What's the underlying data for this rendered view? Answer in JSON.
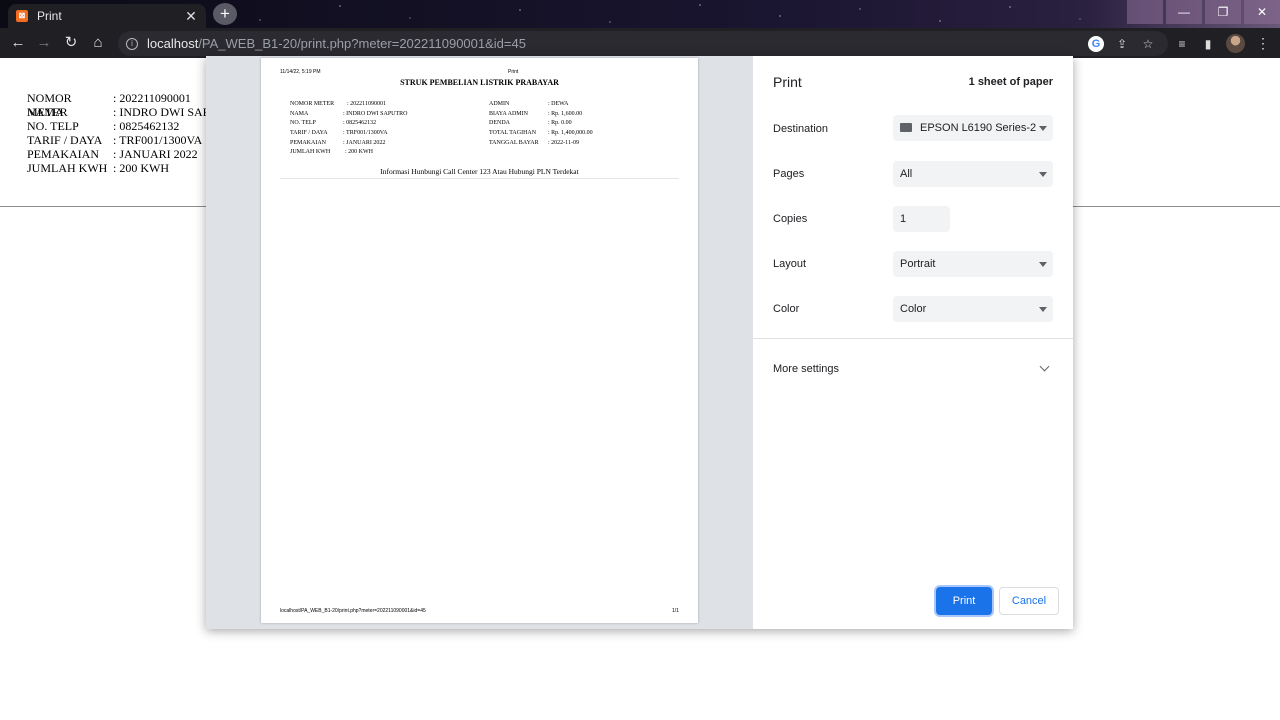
{
  "browser": {
    "tab_title": "Print",
    "url_host": "localhost",
    "url_path": "/PA_WEB_B1-20/print.php?meter=202211090001&id=45"
  },
  "underlay": {
    "rows": [
      {
        "k": "NOMOR METER",
        "v": ": 202211090001"
      },
      {
        "k": "NAMA",
        "v": ": INDRO DWI SAPUT"
      },
      {
        "k": "NO. TELP",
        "v": ": 0825462132"
      },
      {
        "k": "TARIF / DAYA",
        "v": ": TRF001/1300VA"
      },
      {
        "k": "PEMAKAIAN",
        "v": ": JANUARI 2022"
      },
      {
        "k": "JUMLAH KWH",
        "v": ": 200 KWH"
      }
    ]
  },
  "preview": {
    "header_date": "11/14/22, 5:19 PM",
    "header_title": "Print",
    "title": "STRUK PEMBELIAN LISTRIK PRABAYAR",
    "left_rows": [
      {
        "k": "NOMOR METER",
        "v": ": 202211090001"
      },
      {
        "k": "NAMA",
        "v": ": INDRO DWI SAPUTRO"
      },
      {
        "k": "NO. TELP",
        "v": ": 0825462132"
      },
      {
        "k": "TARIF / DAYA",
        "v": ": TRF001/1300VA"
      },
      {
        "k": "PEMAKAIAN",
        "v": ": JANUARI 2022"
      },
      {
        "k": "JUMLAH KWH",
        "v": ": 200 KWH"
      }
    ],
    "right_rows": [
      {
        "k": "ADMIN",
        "v": ": DEWA"
      },
      {
        "k": "BIAYA ADMIN",
        "v": ": Rp. 1,600.00"
      },
      {
        "k": "DENDA",
        "v": ": Rp. 0.00"
      },
      {
        "k": "TOTAL TAGIHAN",
        "v": ": Rp. 1,400,000.00"
      },
      {
        "k": "TANGGAL BAYAR",
        "v": ": 2022-11-09"
      }
    ],
    "info": "Informasi Hunbungi Call Center 123 Atau Hubungi PLN Terdekat",
    "footer_url": "localhost/PA_WEB_B1-20/print.php?meter=202211090001&id=45",
    "footer_page": "1/1"
  },
  "settings": {
    "title": "Print",
    "sheets": "1 sheet of paper",
    "destination_label": "Destination",
    "destination_value": "EPSON L6190 Series-2",
    "pages_label": "Pages",
    "pages_value": "All",
    "copies_label": "Copies",
    "copies_value": "1",
    "layout_label": "Layout",
    "layout_value": "Portrait",
    "color_label": "Color",
    "color_value": "Color",
    "more_settings": "More settings",
    "print_button": "Print",
    "cancel_button": "Cancel"
  }
}
